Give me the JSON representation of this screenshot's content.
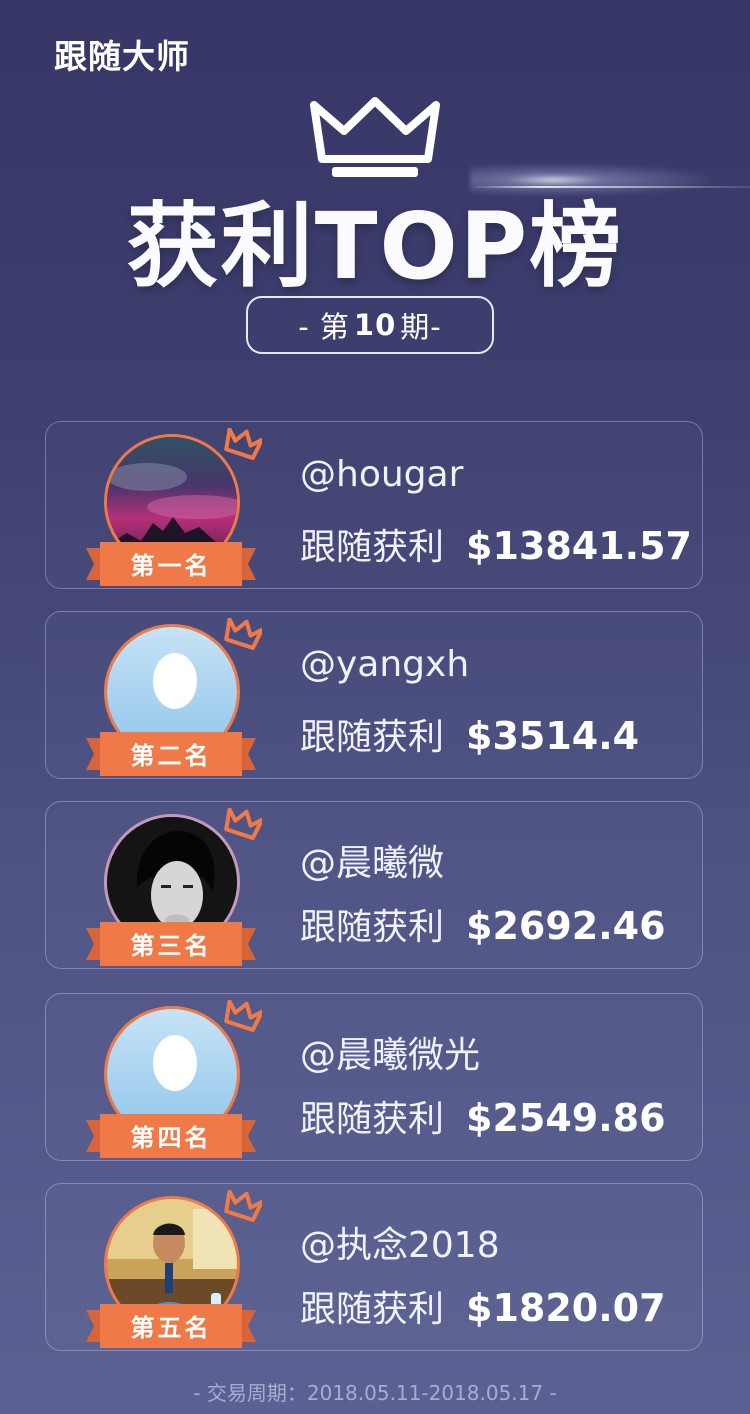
{
  "header": {
    "brand": "跟随大师",
    "title": "获利TOP榜",
    "issue_prefix": "- 第",
    "issue_number": "10",
    "issue_suffix": "期-"
  },
  "profit_label": "跟随获利",
  "ranking": [
    {
      "rank_label": "第一名",
      "username": "@hougar",
      "amount": "$13841.57",
      "avatar": "mountain-photo"
    },
    {
      "rank_label": "第二名",
      "username": "@yangxh",
      "amount": "$3514.4",
      "avatar": "default-avatar"
    },
    {
      "rank_label": "第三名",
      "username": "@晨曦微",
      "amount": "$2692.46",
      "avatar": "portrait-photo"
    },
    {
      "rank_label": "第四名",
      "username": "@晨曦微光",
      "amount": "$2549.86",
      "avatar": "default-avatar"
    },
    {
      "rank_label": "第五名",
      "username": "@执念2018",
      "amount": "$1820.07",
      "avatar": "office-photo"
    }
  ],
  "footer": {
    "period": "- 交易周期：2018.05.11-2018.05.17 -"
  },
  "colors": {
    "accent_orange": "#f07a47",
    "background_top": "#373767",
    "background_bottom": "#5b6192"
  }
}
